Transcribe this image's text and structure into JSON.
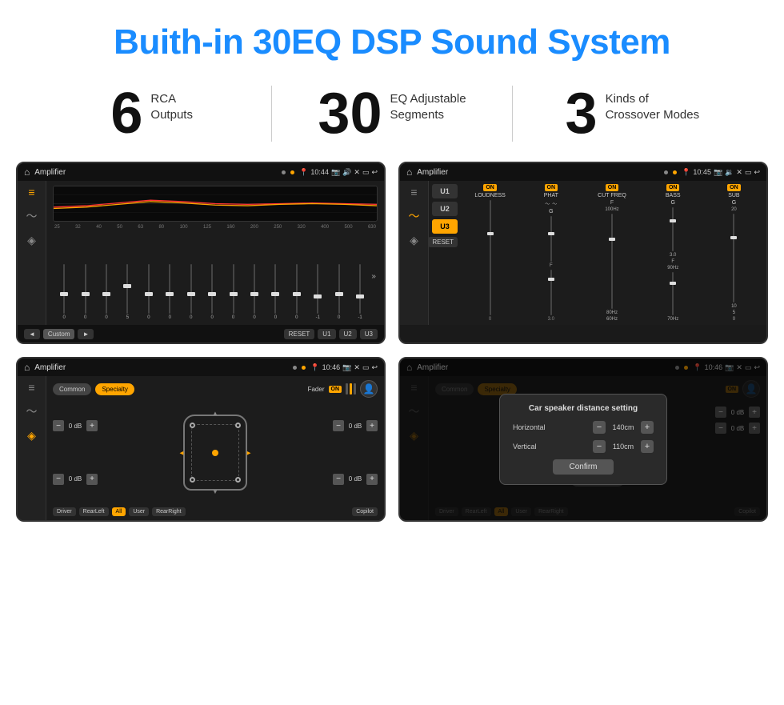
{
  "page": {
    "title": "Buith-in 30EQ DSP Sound System",
    "title_color": "#1a8cff"
  },
  "stats": [
    {
      "number": "6",
      "text_line1": "RCA",
      "text_line2": "Outputs"
    },
    {
      "number": "30",
      "text_line1": "EQ Adjustable",
      "text_line2": "Segments"
    },
    {
      "number": "3",
      "text_line1": "Kinds of",
      "text_line2": "Crossover Modes"
    }
  ],
  "screens": {
    "eq": {
      "status_bar": {
        "title": "Amplifier",
        "time": "10:44"
      },
      "frequencies": [
        "25",
        "32",
        "40",
        "50",
        "63",
        "80",
        "100",
        "125",
        "160",
        "200",
        "250",
        "320",
        "400",
        "500",
        "630"
      ],
      "slider_values": [
        "0",
        "0",
        "0",
        "5",
        "0",
        "0",
        "0",
        "0",
        "0",
        "0",
        "0",
        "0",
        "-1",
        "0",
        "-1"
      ],
      "buttons": [
        "◄",
        "Custom",
        "►",
        "RESET",
        "U1",
        "U2",
        "U3"
      ]
    },
    "crossover": {
      "status_bar": {
        "title": "Amplifier",
        "time": "10:45"
      },
      "presets": [
        "U1",
        "U2",
        "U3"
      ],
      "channels": [
        {
          "on": true,
          "label": "LOUDNESS"
        },
        {
          "on": true,
          "label": "PHAT"
        },
        {
          "on": true,
          "label": "CUT FREQ"
        },
        {
          "on": true,
          "label": "BASS"
        },
        {
          "on": true,
          "label": "SUB"
        }
      ],
      "reset_label": "RESET"
    },
    "fader": {
      "status_bar": {
        "title": "Amplifier",
        "time": "10:46"
      },
      "common_label": "Common",
      "specialty_label": "Specialty",
      "fader_label": "Fader",
      "on_label": "ON",
      "db_values": [
        "0 dB",
        "0 dB",
        "0 dB",
        "0 dB"
      ],
      "footer_buttons": [
        "Driver",
        "RearLeft",
        "All",
        "User",
        "RearRight",
        "Copilot"
      ]
    },
    "dialog": {
      "status_bar": {
        "title": "Amplifier",
        "time": "10:46"
      },
      "common_label": "Common",
      "specialty_label": "Specialty",
      "dialog_title": "Car speaker distance setting",
      "horizontal_label": "Horizontal",
      "horizontal_value": "140cm",
      "vertical_label": "Vertical",
      "vertical_value": "110cm",
      "confirm_label": "Confirm",
      "db_values": [
        "0 dB",
        "0 dB"
      ],
      "footer_buttons": [
        "Driver",
        "RearLeft",
        "All",
        "User",
        "RearRight",
        "Copilot"
      ]
    }
  }
}
